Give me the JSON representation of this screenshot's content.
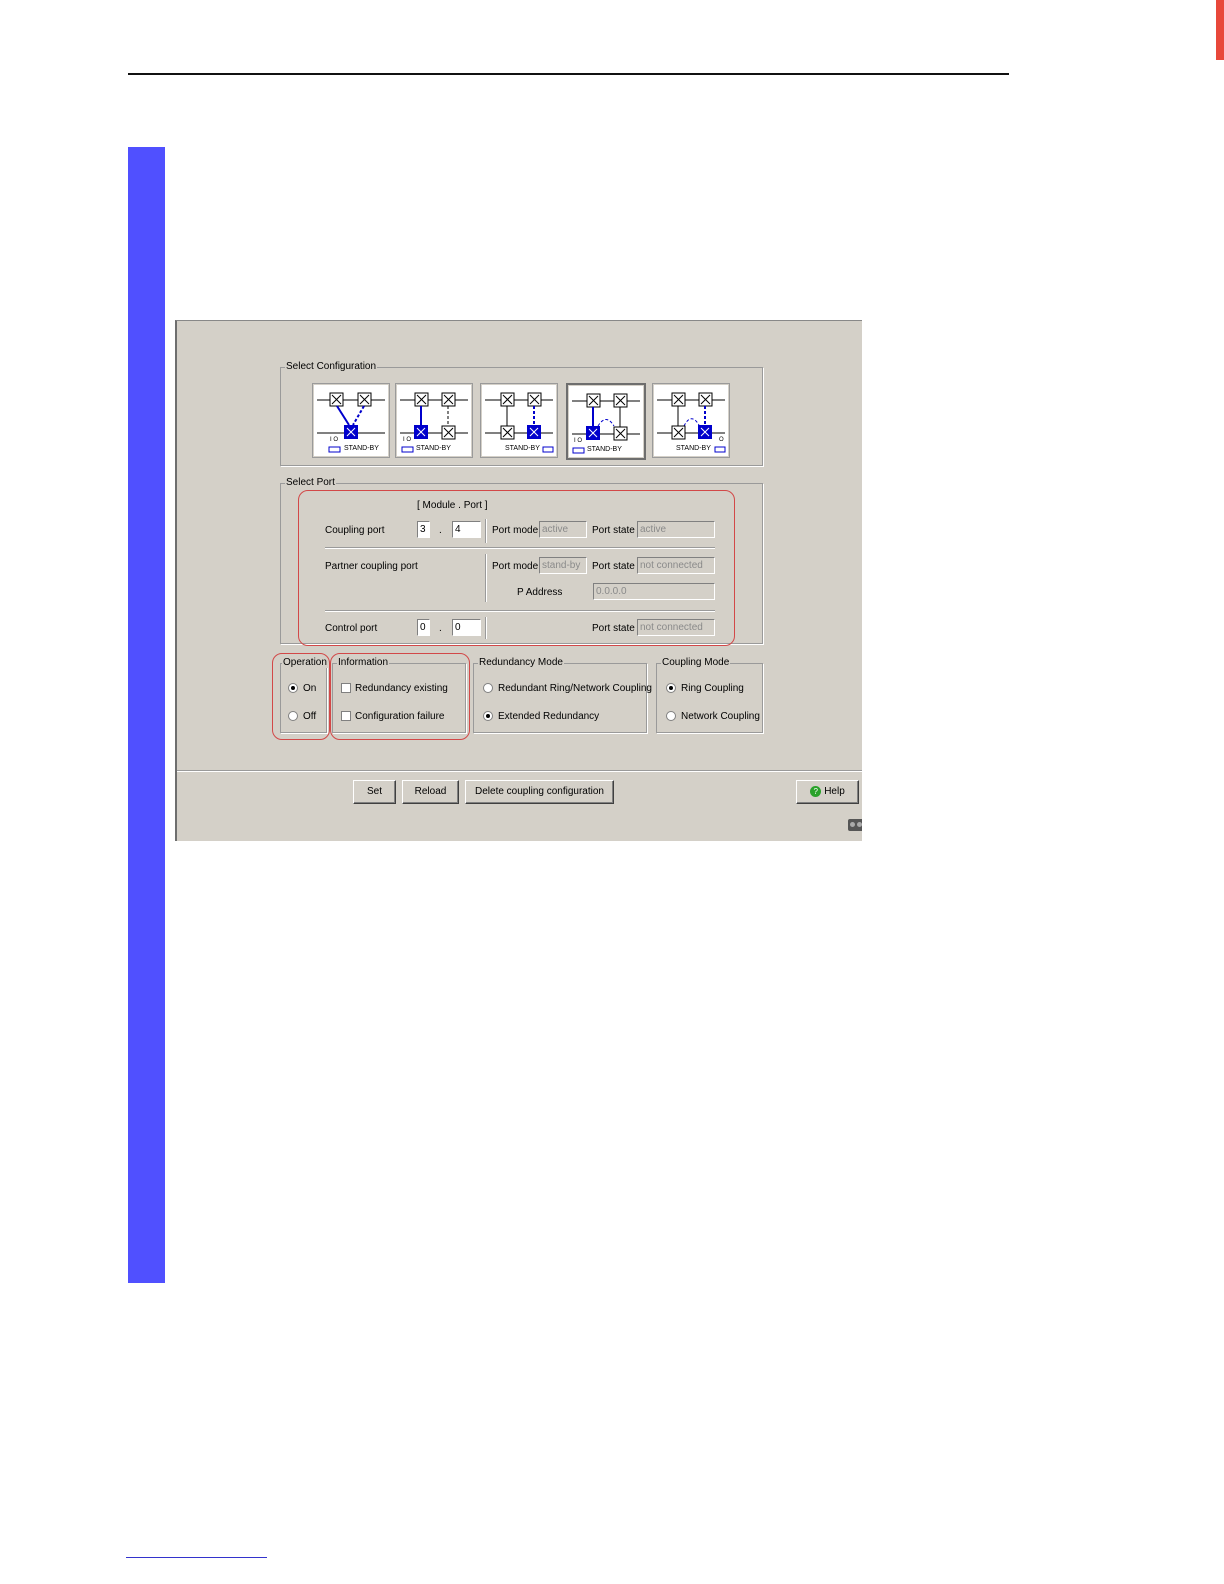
{
  "colors": {
    "accent_bar": "#5050ff",
    "highlight": "#d24848",
    "switch_active": "#0000cc",
    "window_bg": "#d4d0c8"
  },
  "select_configuration": {
    "title": "Select Configuration",
    "options": [
      {
        "icon": "ring-coupling-one-switch-icon",
        "caption": "STAND-BY",
        "code": "I O"
      },
      {
        "icon": "ring-coupling-two-switch-icon",
        "caption": "STAND-BY",
        "code": "I O"
      },
      {
        "icon": "ring-coupling-two-switch-right-icon",
        "caption": "STAND-BY",
        "code": ""
      },
      {
        "icon": "network-coupling-two-switch-icon",
        "caption": "STAND-BY",
        "code": "I O"
      },
      {
        "icon": "network-coupling-two-switch-right-icon",
        "caption": "STAND-BY",
        "code": "O"
      }
    ]
  },
  "select_port": {
    "title": "Select Port",
    "module_port_header": "[ Module . Port ]",
    "coupling_port": {
      "label": "Coupling port",
      "module": "3",
      "dot": ".",
      "port": "4",
      "port_mode_label": "Port mode",
      "port_mode": "active",
      "port_state_label": "Port state",
      "port_state": "active"
    },
    "partner_port": {
      "label": "Partner coupling port",
      "port_mode_label": "Port mode",
      "port_mode": "stand-by",
      "port_state_label": "Port state",
      "port_state": "not connected",
      "ip_label": "P Address",
      "ip": "0.0.0.0"
    },
    "control_port": {
      "label": "Control port",
      "module": "0",
      "dot": ".",
      "port": "0",
      "port_state_label": "Port state",
      "port_state": "not connected"
    }
  },
  "operation": {
    "title": "Operation",
    "on": "On",
    "off": "Off",
    "selected": "On"
  },
  "information": {
    "title": "Information",
    "redundancy_existing": "Redundancy existing",
    "configuration_failure": "Configuration failure"
  },
  "redundancy_mode": {
    "title": "Redundancy Mode",
    "option1": "Redundant Ring/Network Coupling",
    "option2": "Extended Redundancy",
    "selected": "Extended Redundancy"
  },
  "coupling_mode": {
    "title": "Coupling Mode",
    "option1": "Ring Coupling",
    "option2": "Network Coupling",
    "selected": "Ring Coupling"
  },
  "buttons": {
    "set": "Set",
    "reload": "Reload",
    "delete": "Delete coupling configuration",
    "help": "Help"
  }
}
